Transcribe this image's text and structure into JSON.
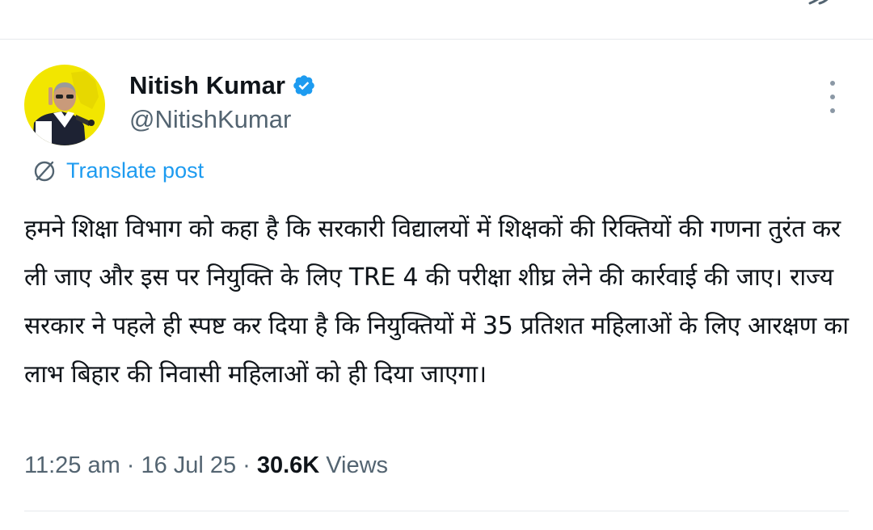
{
  "author": {
    "display_name": "Nitish Kumar",
    "handle": "@NitishKumar"
  },
  "icons": {
    "verified": "verified-badge-icon",
    "more": "more-vertical-icon",
    "translate": "translate-globe-icon"
  },
  "colors": {
    "accent": "#1d9bf0",
    "secondary_text": "#536471",
    "primary_text": "#0f1419",
    "avatar_bg": "#f2e600"
  },
  "translate_label": "Translate post",
  "tweet_text": "हमने शिक्षा विभाग को कहा है कि सरकारी विद्यालयों में शिक्षकों की रिक्तियों की गणना तुरंत कर ली जाए और इस पर नियुक्ति के लिए TRE 4 की परीक्षा शीघ्र लेने की कार्रवाई की जाए। राज्य सरकार ने पहले ही स्पष्ट कर दिया है कि नियुक्तियों में 35 प्रतिशत महिलाओं के लिए आरक्षण का लाभ बिहार की निवासी महिलाओं को ही दिया जाएगा।",
  "meta": {
    "time": "11:25 am",
    "date": "16 Jul 25",
    "views_count": "30.6K",
    "views_label": "Views",
    "separator": "·"
  }
}
